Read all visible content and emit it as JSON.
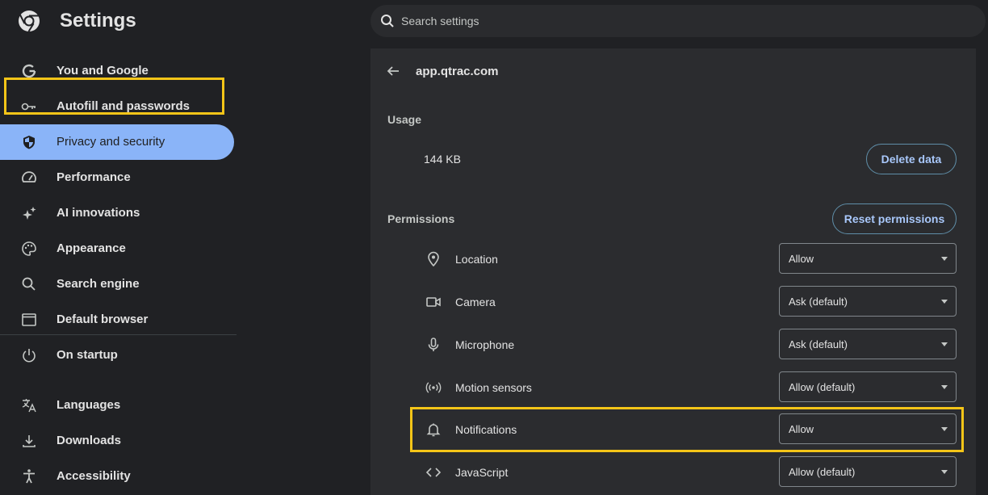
{
  "app": {
    "title": "Settings"
  },
  "search": {
    "placeholder": "Search settings"
  },
  "sidebar": {
    "items": [
      {
        "label": "You and Google",
        "icon": "google-g-icon"
      },
      {
        "label": "Autofill and passwords",
        "icon": "key-icon"
      },
      {
        "label": "Privacy and security",
        "icon": "shield-icon",
        "active": true
      },
      {
        "label": "Performance",
        "icon": "speedometer-icon"
      },
      {
        "label": "AI innovations",
        "icon": "sparkle-icon"
      },
      {
        "label": "Appearance",
        "icon": "palette-icon"
      },
      {
        "label": "Search engine",
        "icon": "search-icon"
      },
      {
        "label": "Default browser",
        "icon": "browser-window-icon"
      },
      {
        "label": "On startup",
        "icon": "power-icon"
      },
      {
        "label": "Languages",
        "icon": "translate-icon"
      },
      {
        "label": "Downloads",
        "icon": "download-icon"
      },
      {
        "label": "Accessibility",
        "icon": "accessibility-icon"
      }
    ]
  },
  "site": {
    "name": "app.qtrac.com"
  },
  "usage": {
    "label": "Usage",
    "value": "144 KB",
    "delete_label": "Delete data"
  },
  "permissions": {
    "label": "Permissions",
    "reset_label": "Reset permissions",
    "rows": [
      {
        "label": "Location",
        "value": "Allow",
        "icon": "location-pin-icon"
      },
      {
        "label": "Camera",
        "value": "Ask (default)",
        "icon": "camera-icon"
      },
      {
        "label": "Microphone",
        "value": "Ask (default)",
        "icon": "microphone-icon"
      },
      {
        "label": "Motion sensors",
        "value": "Allow (default)",
        "icon": "motion-sensor-icon"
      },
      {
        "label": "Notifications",
        "value": "Allow",
        "icon": "bell-icon"
      },
      {
        "label": "JavaScript",
        "value": "Allow (default)",
        "icon": "code-icon"
      }
    ]
  },
  "colors": {
    "accent": "#8ab4f8",
    "highlight": "#f5c518",
    "background": "#202124",
    "panel": "#2b2c2f"
  }
}
